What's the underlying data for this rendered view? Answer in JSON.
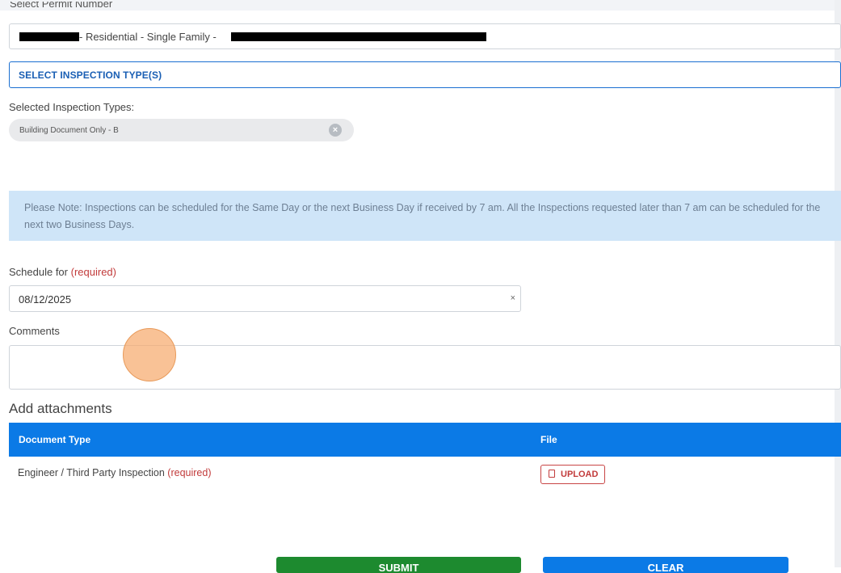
{
  "form": {
    "permit_label": "Select Permit Number",
    "permit_value_text": "- Residential - Single Family -",
    "select_type_button": "SELECT INSPECTION TYPE(S)",
    "selected_types_label": "Selected Inspection Types:",
    "selected_types": [
      {
        "label": "Building Document Only - B"
      }
    ],
    "note": "Please Note: Inspections can be scheduled for the Same Day or the next Business Day if received by 7 am. All the Inspections requested later than 7 am can be scheduled for the next two Business Days.",
    "schedule_label": "Schedule for",
    "required_text": "(required)",
    "schedule_value": "08/12/2025",
    "clear_icon": "×",
    "comments_label": "Comments"
  },
  "attachments": {
    "title": "Add attachments",
    "columns": [
      "Document Type",
      "File"
    ],
    "rows": [
      {
        "document_type": "Engineer / Third Party Inspection",
        "required": "(required)",
        "file_button": "UPLOAD"
      }
    ]
  },
  "actions": {
    "submit_label": "SUBMIT",
    "clear_label": "CLEAR"
  },
  "colors": {
    "primary_blue": "#0b7ae6",
    "submit_green": "#1d8a2f",
    "required_red": "#c23b3b",
    "note_bg": "#cfe5f8"
  }
}
